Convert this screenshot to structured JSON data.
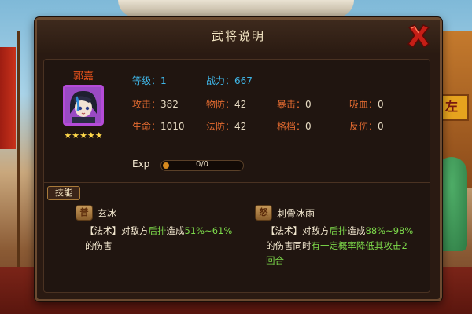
{
  "window": {
    "title": "武将说明"
  },
  "hero": {
    "name": "郭嘉",
    "stars": "★★★★★",
    "level_label": "等级：",
    "level_value": "1",
    "power_label": "战力：",
    "power_value": "667"
  },
  "stats": [
    {
      "label": "攻击：",
      "value": "382"
    },
    {
      "label": "物防：",
      "value": "42"
    },
    {
      "label": "暴击：",
      "value": "0"
    },
    {
      "label": "吸血：",
      "value": "0"
    },
    {
      "label": "生命：",
      "value": "1010"
    },
    {
      "label": "法防：",
      "value": "42"
    },
    {
      "label": "格档：",
      "value": "0"
    },
    {
      "label": "反伤：",
      "value": "0"
    }
  ],
  "exp": {
    "label": "Exp",
    "text": "0/0",
    "progress": 0
  },
  "skills": {
    "tab_label": "技能",
    "items": [
      {
        "badge": "普",
        "name": "玄冰",
        "desc_prefix": "【法术】对敌方",
        "desc_target": "后排",
        "desc_mid": "造成",
        "desc_value": "51%~61%",
        "desc_line2": "的伤害"
      },
      {
        "badge": "怒",
        "name": "刺骨冰雨",
        "desc_prefix": "【法术】对敌方",
        "desc_target": "后排",
        "desc_mid": "造成",
        "desc_value": "88%~98%",
        "desc_line2_prefix": "的伤害同时",
        "desc_line2_effect": "有一定概率降低其攻击2",
        "desc_line3": "回合"
      }
    ]
  },
  "background": {
    "sign_text": "左"
  },
  "colors": {
    "accent_blue": "#3fb6e8",
    "accent_orange": "#e26a30",
    "highlight_green": "#7cd84a",
    "title_text": "#f4e6c4"
  },
  "icons": {
    "close": "close-x-icon",
    "portrait": "hero-portrait-icon"
  }
}
